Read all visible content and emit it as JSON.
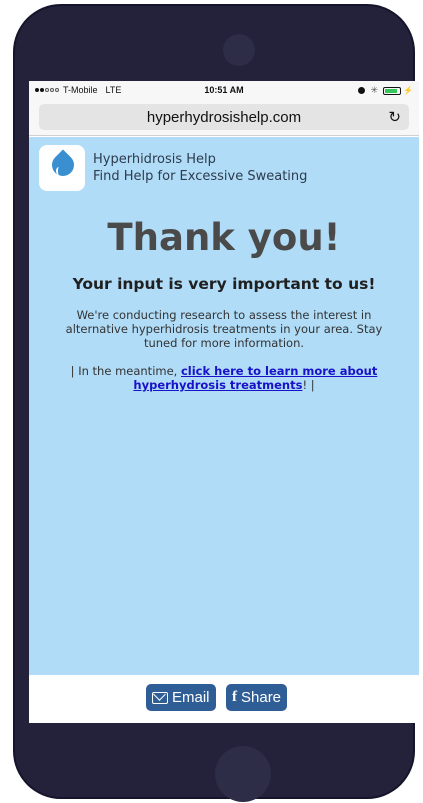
{
  "status_bar": {
    "carrier": "T-Mobile",
    "network": "LTE",
    "time": "10:51 AM"
  },
  "browser": {
    "url": "hyperhydrosishelp.com"
  },
  "site": {
    "name": "Hyperhidrosis Help",
    "tagline": "Find Help for Excessive Sweating"
  },
  "content": {
    "title": "Thank you!",
    "subtitle": "Your input is very important to us!",
    "research_text": "We're conducting research to assess the interest in alternative hyperhidrosis treatments in your area. Stay tuned for more information.",
    "meantime_prefix": "| In the meantime, ",
    "link_text": "click here to learn more about hyperhydrosis treatments",
    "meantime_suffix": "! |"
  },
  "footer": {
    "email_label": "Email",
    "share_label": "Share"
  },
  "colors": {
    "page_background": "#b0dcf7",
    "phone_body": "#23223a",
    "button": "#2f5e96",
    "link": "#1a12c8"
  },
  "icons": [
    "signal-dots-icon",
    "alarm-icon",
    "bluetooth-icon",
    "battery-icon",
    "reload-icon",
    "water-drop-logo",
    "mail-icon",
    "facebook-icon"
  ]
}
